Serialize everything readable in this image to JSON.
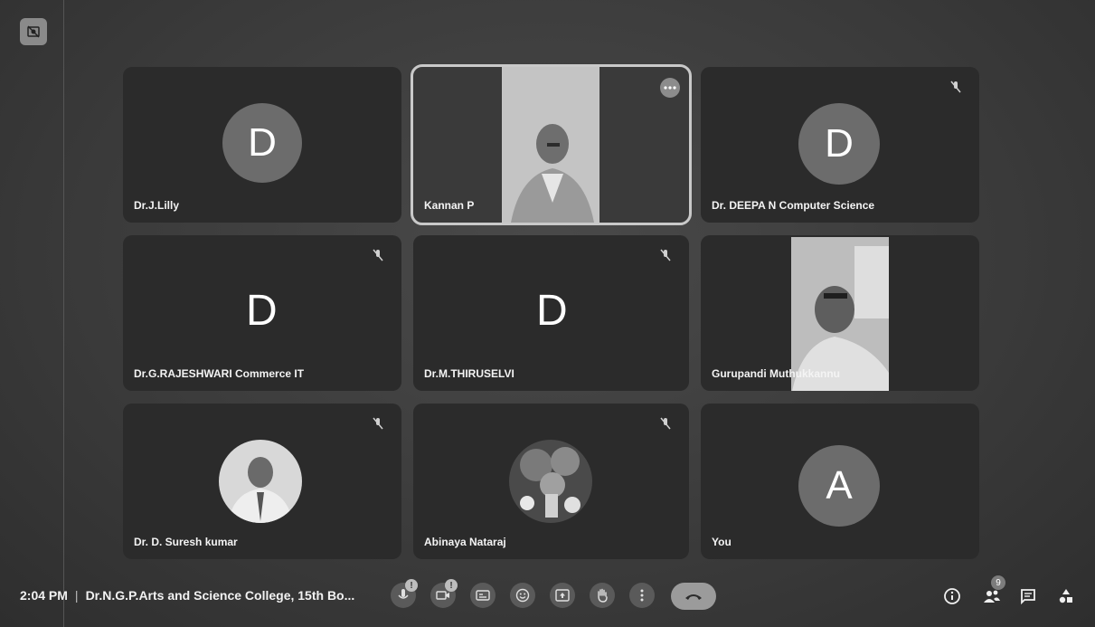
{
  "corner": {
    "icon": "hide-self-view-icon"
  },
  "tiles": [
    {
      "name": "Dr.J.Lilly",
      "letter": "D",
      "muted": false
    },
    {
      "name": "Kannan P",
      "video": true
    },
    {
      "name": "Dr. DEEPA N Computer Science",
      "letter": "D",
      "muted": true
    },
    {
      "name": "Dr.G.RAJESHWARI Commerce IT",
      "letter": "D",
      "muted": true
    },
    {
      "name": "Dr.M.THIRUSELVI",
      "letter": "D",
      "muted": true
    },
    {
      "name": "Gurupandi Muthukkannu",
      "video": true
    },
    {
      "name": "Dr. D. Suresh kumar",
      "photo": true,
      "muted": true
    },
    {
      "name": "Abinaya Nataraj",
      "photo": true,
      "muted": true
    },
    {
      "name": "You",
      "letter": "A"
    }
  ],
  "bottom": {
    "time": "2:04 PM",
    "separator": "|",
    "meeting_title": "Dr.N.G.P.Arts and Science College, 15th Bo...",
    "mic_badge": "!",
    "camera_badge": "!",
    "people_count": "9"
  },
  "icons": {
    "mic": "mic-icon",
    "camera": "camera-icon",
    "captions": "captions-icon",
    "emoji": "emoji-icon",
    "present": "present-icon",
    "hand": "raise-hand-icon",
    "more": "more-vert-icon",
    "leave": "leave-call-icon",
    "info": "info-icon",
    "people": "people-icon",
    "chat": "chat-icon",
    "activities": "activities-icon"
  }
}
